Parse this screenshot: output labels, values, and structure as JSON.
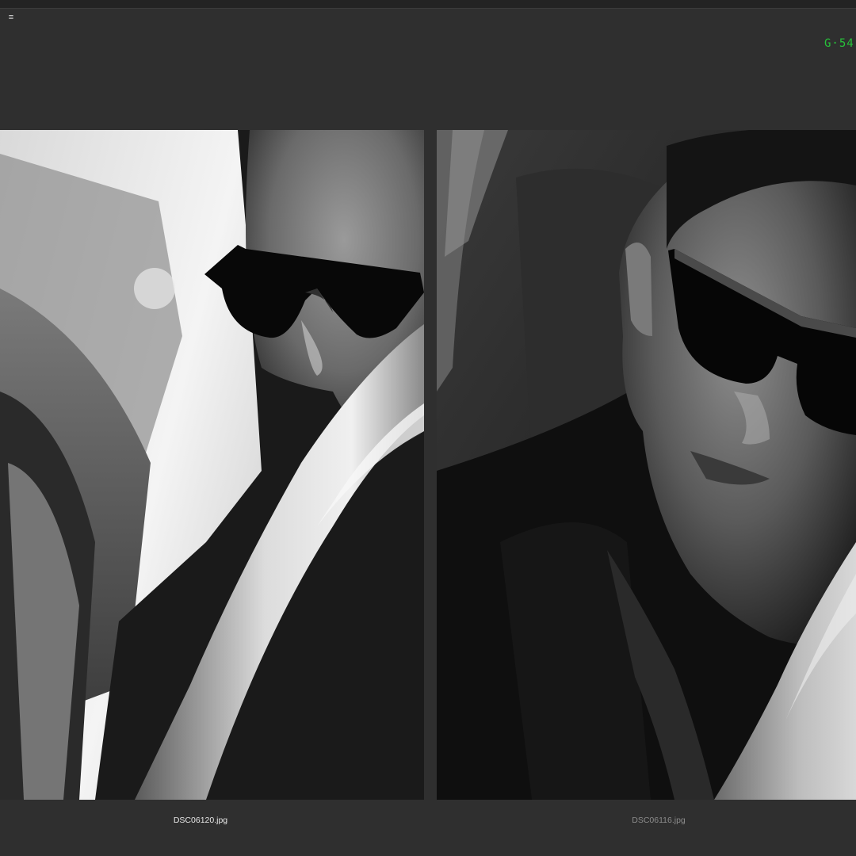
{
  "toolbar": {
    "menu_icon": "hamburger-menu-icon",
    "menu_glyph": "≡"
  },
  "status": {
    "readout_text": "G·54"
  },
  "photos": [
    {
      "filename": "DSC06120.jpg",
      "selected": true
    },
    {
      "filename": "DSC06116.jpg",
      "selected": false
    }
  ],
  "colors": {
    "background": "#2f2f2f",
    "readout": "#27c23a",
    "caption_selected": "#e6e6e6",
    "caption_unselected": "#8c8c8c"
  }
}
